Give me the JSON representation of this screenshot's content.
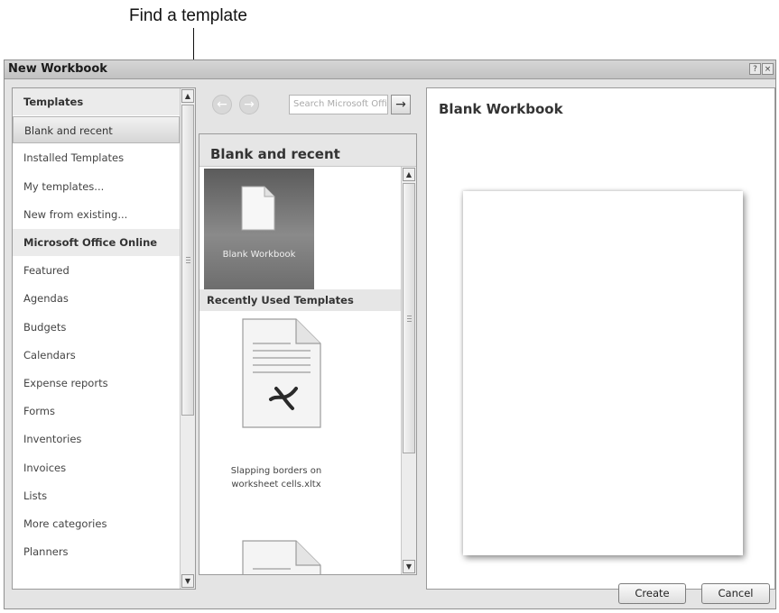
{
  "callout": {
    "text": "Find a template"
  },
  "window": {
    "title": "New Workbook",
    "help_glyph": "?",
    "close_glyph": "×"
  },
  "left_panel": {
    "items": [
      {
        "label": "Templates",
        "type": "header"
      },
      {
        "label": "Blank and recent",
        "type": "selected"
      },
      {
        "label": "Installed Templates",
        "type": "item"
      },
      {
        "label": "My templates...",
        "type": "item"
      },
      {
        "label": "New from existing...",
        "type": "item"
      },
      {
        "label": "Microsoft Office Online",
        "type": "header"
      },
      {
        "label": "Featured",
        "type": "item"
      },
      {
        "label": "Agendas",
        "type": "item"
      },
      {
        "label": "Budgets",
        "type": "item"
      },
      {
        "label": "Calendars",
        "type": "item"
      },
      {
        "label": "Expense reports",
        "type": "item"
      },
      {
        "label": "Forms",
        "type": "item"
      },
      {
        "label": "Inventories",
        "type": "item"
      },
      {
        "label": "Invoices",
        "type": "item"
      },
      {
        "label": "Lists",
        "type": "item"
      },
      {
        "label": "More categories",
        "type": "item"
      },
      {
        "label": "Planners",
        "type": "item"
      }
    ]
  },
  "search": {
    "placeholder": "Search Microsoft Office Online",
    "back_glyph": "←",
    "forward_glyph": "→",
    "go_glyph": "→"
  },
  "middle_panel": {
    "header": "Blank and recent",
    "blank_tile_label": "Blank Workbook",
    "recent_header": "Recently Used Templates",
    "recent_item_caption": "Slapping borders on worksheet cells.xltx"
  },
  "scroll_glyphs": {
    "up": "▲",
    "down": "▼"
  },
  "preview": {
    "title": "Blank Workbook"
  },
  "buttons": {
    "create": "Create",
    "cancel": "Cancel"
  },
  "colors": {
    "dialog_bg": "#e4e4e4",
    "tile_bg": "#6d6d6d",
    "border": "#9a9a9a"
  },
  "icons": [
    "blank-document-icon",
    "excel-template-icon",
    "document-icon",
    "back-arrow-icon",
    "forward-arrow-icon",
    "search-go-arrow-icon"
  ]
}
